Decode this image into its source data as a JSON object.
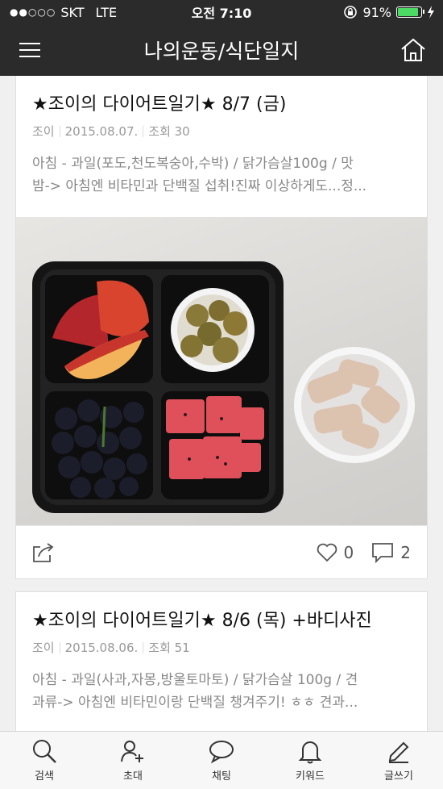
{
  "status_bar": {
    "carrier": "SKT",
    "network": "LTE",
    "time": "오전 7:10",
    "battery_percent": "91%",
    "battery_level": 0.91
  },
  "header": {
    "title": "나의운동/식단일지",
    "menu_icon": "hamburger-icon",
    "home_icon": "home-icon"
  },
  "posts": [
    {
      "title": "★조이의 다이어트일기★ 8/7 (금)",
      "author": "조이",
      "date": "2015.08.07.",
      "views": "조회 30",
      "excerpt_line1": "아침 - 과일(포도,천도복숭아,수박) / 닭가슴살100g / 맛",
      "excerpt_line2": "밤-> 아침엔 비타민과 단백질 섭취!진짜 이상하게도...정...",
      "likes": "0",
      "comments": "2"
    },
    {
      "title": "★조이의 다이어트일기★ 8/6 (목) +바디사진",
      "author": "조이",
      "date": "2015.08.06.",
      "views": "조회 51",
      "excerpt_line1": "아침 - 과일(사과,자몽,방울토마토) / 닭가슴살 100g / 견",
      "excerpt_line2": "과류-> 아침엔 비타민이랑 단백질 챙겨주기! ㅎㅎ 견과..."
    }
  ],
  "tabbar": [
    {
      "label": "검색",
      "icon": "search-icon"
    },
    {
      "label": "초대",
      "icon": "invite-user-icon"
    },
    {
      "label": "채팅",
      "icon": "chat-icon"
    },
    {
      "label": "키워드",
      "icon": "bell-icon"
    },
    {
      "label": "글쓰기",
      "icon": "pencil-icon"
    }
  ],
  "colors": {
    "header_bg": "#2b2b2b",
    "battery_green": "#4cd964",
    "text_muted": "#999999"
  }
}
